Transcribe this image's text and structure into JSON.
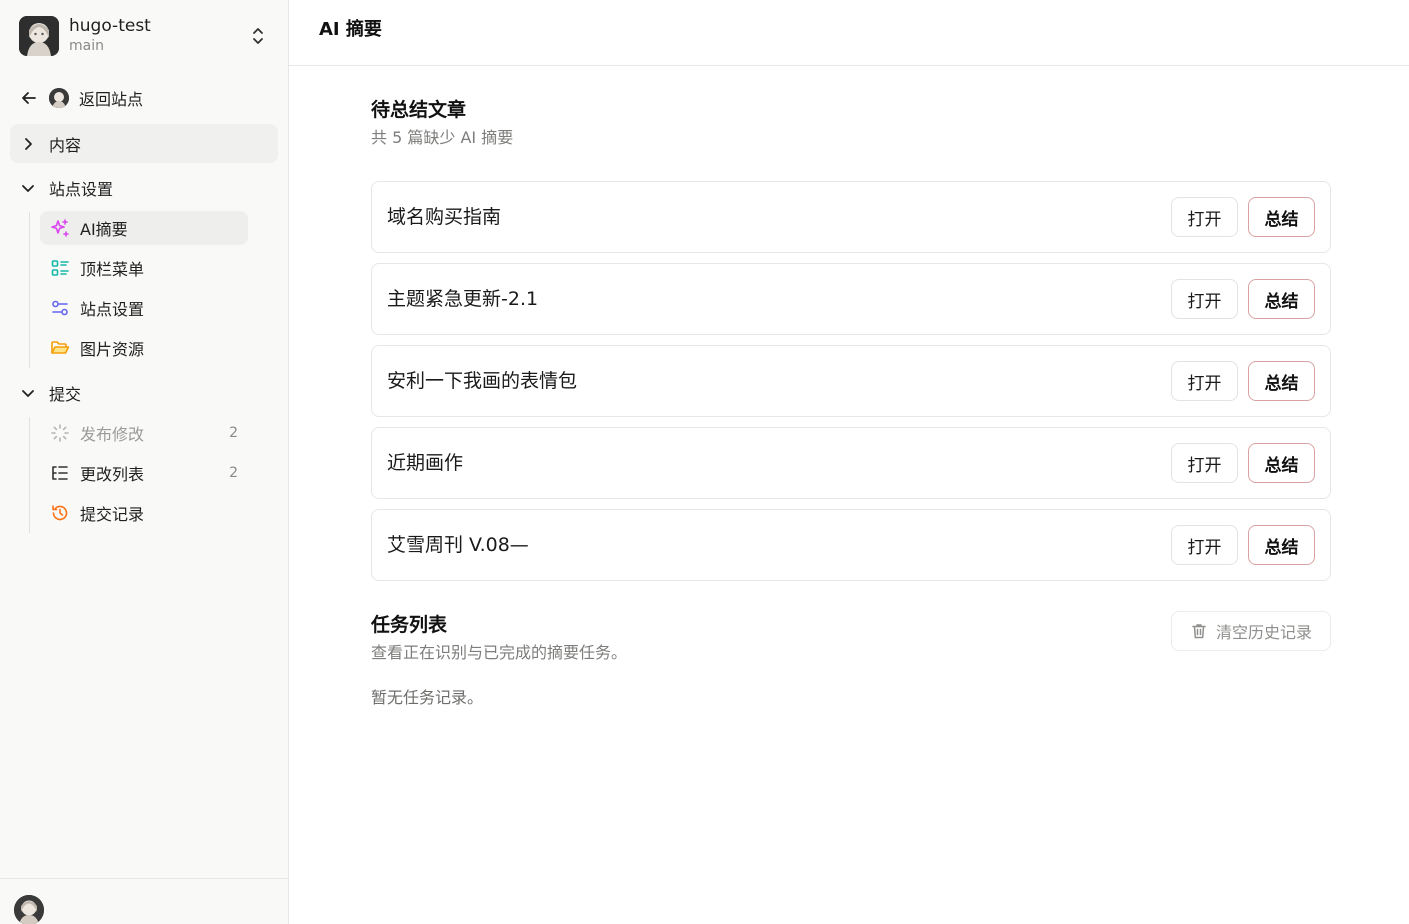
{
  "repo": {
    "name": "hugo-test",
    "branch": "main"
  },
  "sidebar": {
    "back_label": "返回站点",
    "content_label": "内容",
    "settings_group_label": "站点设置",
    "settings_items": [
      {
        "label": "AI摘要",
        "icon": "sparkles-icon",
        "color": "#d946ef"
      },
      {
        "label": "顶栏菜单",
        "icon": "layout-list-icon",
        "color": "#14b8a6"
      },
      {
        "label": "站点设置",
        "icon": "sliders-icon",
        "color": "#6366f1"
      },
      {
        "label": "图片资源",
        "icon": "folder-open-icon",
        "color": "#f59e0b"
      }
    ],
    "submit_group_label": "提交",
    "submit_items": [
      {
        "label": "发布修改",
        "icon": "loader-icon",
        "count": "2"
      },
      {
        "label": "更改列表",
        "icon": "list-tree-icon",
        "count": "2"
      },
      {
        "label": "提交记录",
        "icon": "history-icon",
        "color": "#f97316"
      }
    ]
  },
  "page": {
    "title": "AI 摘要"
  },
  "pending": {
    "title": "待总结文章",
    "subtitle": "共 5 篇缺少 AI 摘要",
    "open_label": "打开",
    "summarize_label": "总结",
    "articles": [
      {
        "title": "域名购买指南"
      },
      {
        "title": "主题紧急更新-2.1"
      },
      {
        "title": "安利一下我画的表情包"
      },
      {
        "title": "近期画作"
      },
      {
        "title": "艾雪周刊 V.08—"
      }
    ]
  },
  "tasks": {
    "title": "任务列表",
    "subtitle": "查看正在识别与已完成的摘要任务。",
    "clear_label": "清空历史记录",
    "empty": "暂无任务记录。"
  }
}
